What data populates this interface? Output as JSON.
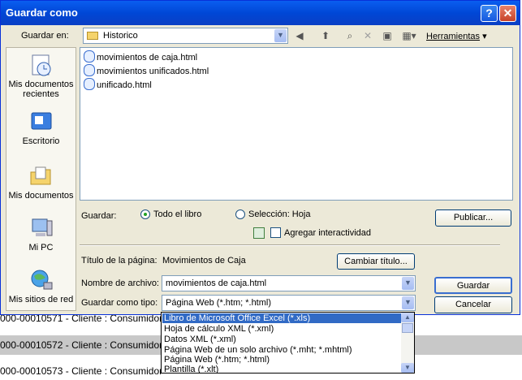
{
  "background_rows": [
    "000-00010571 - Cliente : Consumidor",
    "000-00010572 - Cliente : Consumidor",
    "000-00010573 - Cliente : Consumidor"
  ],
  "dialog": {
    "title": "Guardar como",
    "help_glyph": "?",
    "close_glyph": "✕"
  },
  "toolbar": {
    "save_in_label": "Guardar en:",
    "save_in_value": "Historico",
    "tools_label": "Herramientas"
  },
  "places": [
    {
      "label": "Mis documentos recientes",
      "icon": "recent-documents-icon"
    },
    {
      "label": "Escritorio",
      "icon": "desktop-icon"
    },
    {
      "label": "Mis documentos",
      "icon": "my-documents-icon"
    },
    {
      "label": "Mi PC",
      "icon": "my-computer-icon"
    },
    {
      "label": "Mis sitios de red",
      "icon": "network-places-icon"
    }
  ],
  "files": [
    "movimientos de caja.html",
    "movimientos unificados.html",
    "unificado.html"
  ],
  "options": {
    "save_label": "Guardar:",
    "radio_all": "Todo el libro",
    "radio_selection": "Selección: Hoja",
    "publish_button": "Publicar...",
    "interactivity_label": "Agregar interactividad"
  },
  "page_title": {
    "label": "Título de la página:",
    "value": "Movimientos de Caja",
    "change_button": "Cambiar título..."
  },
  "filename": {
    "label": "Nombre de archivo:",
    "value": "movimientos de caja.html",
    "save_button": "Guardar"
  },
  "filetype": {
    "label": "Guardar como tipo:",
    "value": "Página Web (*.htm; *.html)",
    "cancel_button": "Cancelar",
    "options": [
      "Libro de Microsoft Office Excel (*.xls)",
      "Hoja de cálculo XML (*.xml)",
      "Datos XML (*.xml)",
      "Página Web de un solo archivo (*.mht; *.mhtml)",
      "Página Web (*.htm; *.html)",
      "Plantilla (*.xlt)"
    ],
    "selected_index": 0
  },
  "colors": {
    "titlebar": "#0a5ef0",
    "selection": "#316ac5",
    "dialog_bg": "#ece9d8"
  }
}
